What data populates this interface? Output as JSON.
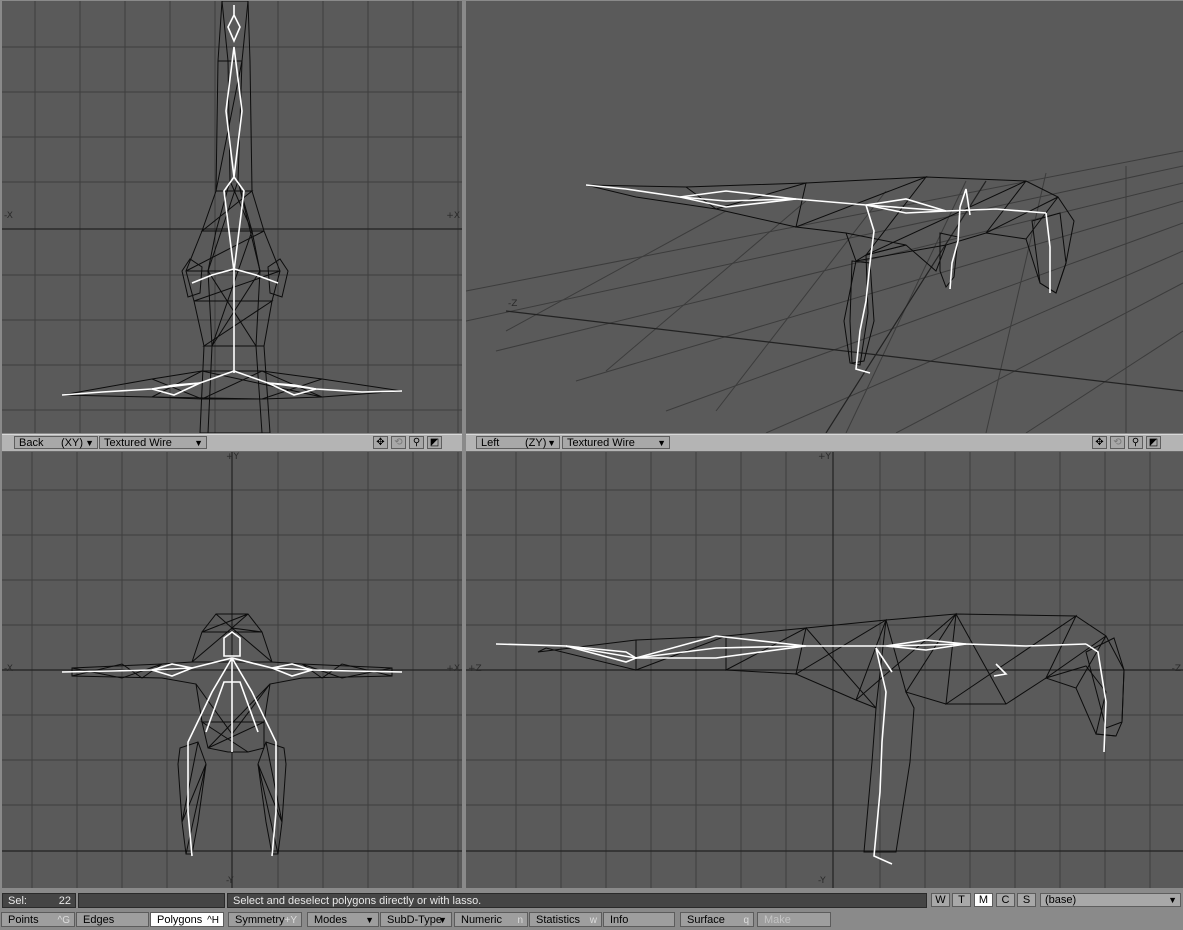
{
  "viewports": {
    "top_left": {
      "axis_labels": {
        "left": "-X",
        "right": "+X"
      }
    },
    "top_right": {
      "axis_labels": {
        "left": "-Z"
      }
    },
    "bottom_left": {
      "view_label": "Back",
      "axis_label": "(XY)",
      "render_mode": "Textured Wire",
      "axis_labels": {
        "top": "+Y",
        "bottom": "-Y",
        "left": "-X",
        "right": "+X"
      }
    },
    "bottom_right": {
      "view_label": "Left",
      "axis_label": "(ZY)",
      "render_mode": "Textured Wire",
      "axis_labels": {
        "top": "+Y",
        "bottom": "-Y",
        "left": "+Z",
        "right": "-Z"
      }
    }
  },
  "status": {
    "sel_label": "Sel:",
    "sel_count": "22",
    "message": "Select and deselect polygons directly or with lasso.",
    "layer_buttons": [
      "W",
      "T",
      "M",
      "C",
      "S"
    ],
    "active_layer_button": "M",
    "surface_name": "(base)"
  },
  "toolbar": {
    "points": {
      "label": "Points",
      "shortcut": "^G"
    },
    "edges": {
      "label": "Edges",
      "shortcut": ""
    },
    "polygons": {
      "label": "Polygons",
      "shortcut": "^H"
    },
    "symmetry": {
      "label": "Symmetry",
      "shortcut": "+Y"
    },
    "modes": {
      "label": "Modes"
    },
    "subd": {
      "label": "SubD-Type"
    },
    "numeric": {
      "label": "Numeric",
      "shortcut": "n"
    },
    "statistics": {
      "label": "Statistics",
      "shortcut": "w"
    },
    "info": {
      "label": "Info"
    },
    "surface": {
      "label": "Surface",
      "shortcut": "q"
    },
    "make": {
      "label": "Make"
    }
  },
  "colors": {
    "viewport_bg": "#5a5a5a",
    "grid": "#3e3e3e",
    "wire": "#0c0c0c",
    "bones": "#ffffff",
    "active_mode": "#ffffff"
  },
  "icons": [
    "move-icon",
    "rotate-icon",
    "zoom-icon",
    "maximize-icon",
    "dropdown-arrow-icon"
  ]
}
